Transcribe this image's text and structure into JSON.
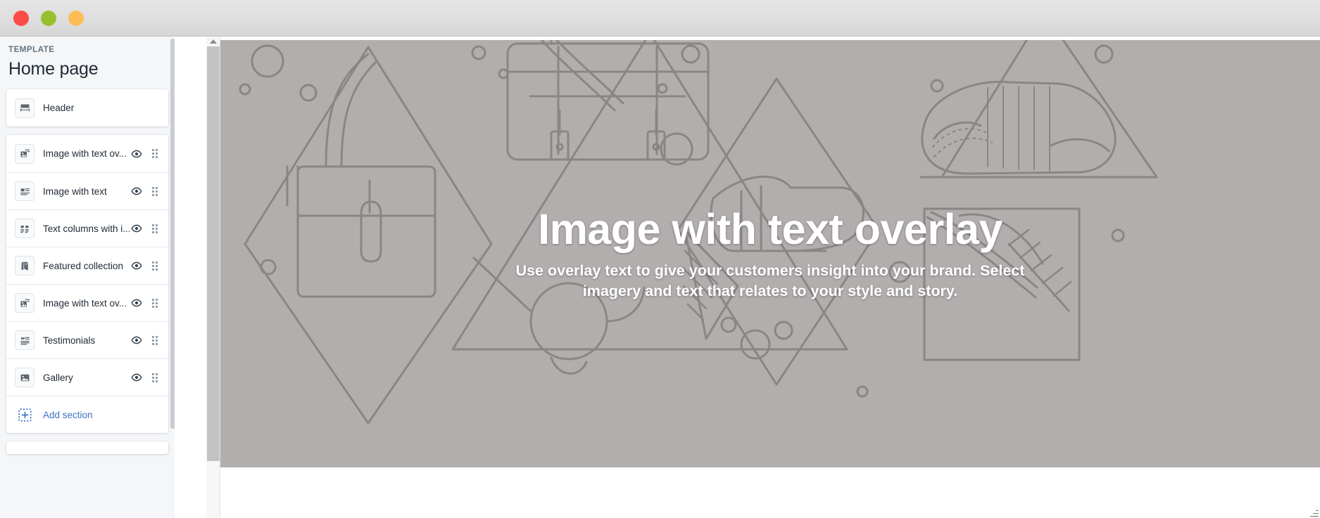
{
  "window": {
    "traffic_lights": [
      {
        "name": "close",
        "color": "#fb4d47"
      },
      {
        "name": "minimize",
        "color": "#98c02e"
      },
      {
        "name": "zoom",
        "color": "#fcbd56"
      }
    ]
  },
  "sidebar": {
    "kicker": "TEMPLATE",
    "title": "Home page",
    "header_section": {
      "label": "Header",
      "icon": "header-layout-icon",
      "has_visibility_toggle": false,
      "has_drag_handle": false
    },
    "sections": [
      {
        "label": "Image with text ov...",
        "icon": "image-with-text-overlay-icon",
        "visible": true
      },
      {
        "label": "Image with text",
        "icon": "image-with-text-icon",
        "visible": true
      },
      {
        "label": "Text columns with i...",
        "icon": "text-columns-with-images-icon",
        "visible": true
      },
      {
        "label": "Featured collection",
        "icon": "tag-icon",
        "visible": true
      },
      {
        "label": "Image with text ov...",
        "icon": "image-with-text-overlay-icon",
        "visible": true
      },
      {
        "label": "Testimonials",
        "icon": "quote-icon",
        "visible": true
      },
      {
        "label": "Gallery",
        "icon": "gallery-image-icon",
        "visible": true
      }
    ],
    "add_section": {
      "label": "Add section",
      "icon": "add-section-plus-icon",
      "color": "#3d72c7"
    },
    "eye_icon": "eye-icon",
    "drag_icon": "drag-handle-icon"
  },
  "preview": {
    "hero": {
      "heading": "Image with text overlay",
      "body": "Use overlay text to give your customers insight into your brand. Select imagery and text that relates to your style and story.",
      "background_color": "#b3aeae",
      "line_color": "#8b8585",
      "text_color": "#ffffff"
    }
  }
}
